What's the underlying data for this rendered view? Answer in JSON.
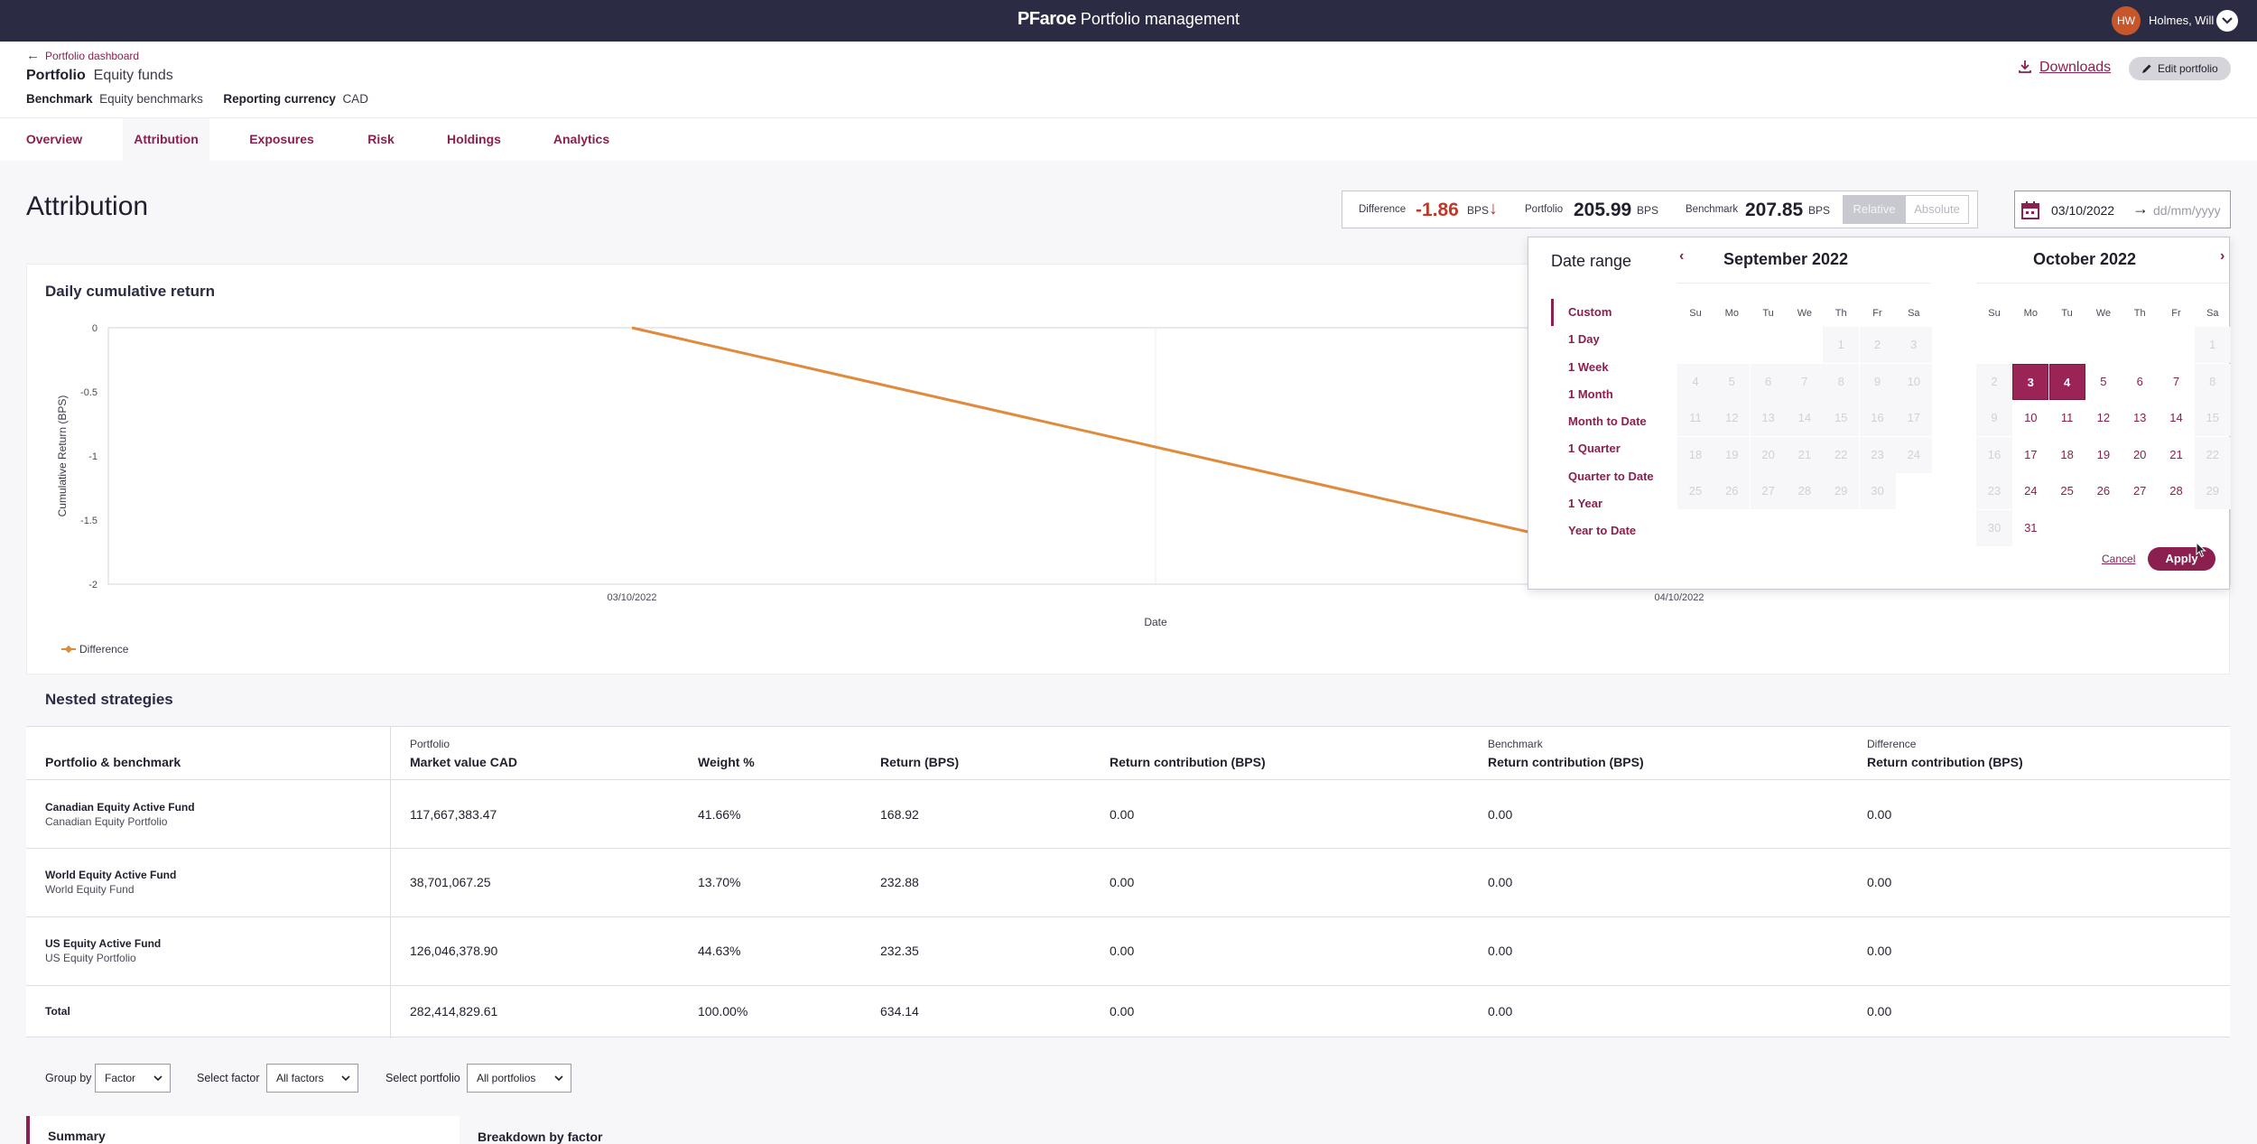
{
  "app": {
    "brand": "PFaroe",
    "title": "Portfolio management",
    "user": {
      "initials": "HW",
      "name": "Holmes, Will"
    }
  },
  "header": {
    "back_label": "Portfolio dashboard",
    "portfolio_key": "Portfolio",
    "portfolio_value": "Equity funds",
    "benchmark_key": "Benchmark",
    "benchmark_value": "Equity benchmarks",
    "currency_key": "Reporting currency",
    "currency_value": "CAD",
    "downloads_label": "Downloads",
    "edit_label": "Edit portfolio"
  },
  "tabs": [
    {
      "label": "Overview"
    },
    {
      "label": "Attribution"
    },
    {
      "label": "Exposures"
    },
    {
      "label": "Risk"
    },
    {
      "label": "Holdings"
    },
    {
      "label": "Analytics"
    }
  ],
  "page_title": "Attribution",
  "summary": {
    "difference_label": "Difference",
    "difference_value": "-1.86",
    "difference_unit": "BPS",
    "difference_arrow": "↓",
    "portfolio_label": "Portfolio",
    "portfolio_value": "205.99",
    "portfolio_unit": "BPS",
    "benchmark_label": "Benchmark",
    "benchmark_value": "207.85",
    "benchmark_unit": "BPS",
    "relative_label": "Relative",
    "absolute_label": "Absolute"
  },
  "date_field": {
    "from": "03/10/2022",
    "arrow": "→",
    "to_placeholder": "dd/mm/yyyy"
  },
  "chart": {
    "title": "Daily cumulative return",
    "legend_label": "Difference"
  },
  "chart_data": {
    "type": "line",
    "title": "Daily cumulative return",
    "xlabel": "Date",
    "ylabel": "Cumulative Return (BPS)",
    "x": [
      "03/10/2022",
      "04/10/2022"
    ],
    "series": [
      {
        "name": "Difference",
        "values": [
          0,
          -1.86
        ],
        "color": "#e08a3c"
      }
    ],
    "ylim": [
      -2,
      0
    ],
    "yticks": [
      "0",
      "-0.5",
      "-1",
      "-1.5",
      "-2"
    ],
    "grid": true,
    "legend": "bottom-left"
  },
  "nested": {
    "title": "Nested strategies",
    "group_portfolio": "Portfolio",
    "group_benchmark": "Benchmark",
    "group_difference": "Difference",
    "headers": {
      "name": "Portfolio & benchmark",
      "market_value": "Market value CAD",
      "weight": "Weight %",
      "return": "Return (BPS)",
      "contribution": "Return contribution (BPS)",
      "bench_contribution": "Return contribution (BPS)",
      "diff_contribution": "Return contribution (BPS)"
    },
    "rows": [
      {
        "name": "Canadian Equity Active Fund",
        "sub": "Canadian Equity Portfolio",
        "mv": "117,667,383.47",
        "weight": "41.66%",
        "ret": "168.92",
        "contrib": "0.00",
        "bench": "0.00",
        "diff": "0.00"
      },
      {
        "name": "World Equity Active Fund",
        "sub": "World Equity Fund",
        "mv": "38,701,067.25",
        "weight": "13.70%",
        "ret": "232.88",
        "contrib": "0.00",
        "bench": "0.00",
        "diff": "0.00"
      },
      {
        "name": "US Equity Active Fund",
        "sub": "US Equity Portfolio",
        "mv": "126,046,378.90",
        "weight": "44.63%",
        "ret": "232.35",
        "contrib": "0.00",
        "bench": "0.00",
        "diff": "0.00"
      },
      {
        "name": "Total",
        "sub": "",
        "mv": "282,414,829.61",
        "weight": "100.00%",
        "ret": "634.14",
        "contrib": "0.00",
        "bench": "0.00",
        "diff": "0.00"
      }
    ]
  },
  "filters": {
    "group_by_label": "Group by",
    "group_by_value": "Factor",
    "factor_label": "Select factor",
    "factor_value": "All factors",
    "portfolio_label": "Select portfolio",
    "portfolio_value": "All portfolios"
  },
  "bottom": {
    "summary_label": "Summary",
    "breakdown_label": "Breakdown by factor"
  },
  "date_picker": {
    "title": "Date range",
    "presets": [
      "Custom",
      "1 Day",
      "1 Week",
      "1 Month",
      "Month to Date",
      "1 Quarter",
      "Quarter to Date",
      "1 Year",
      "Year to Date"
    ],
    "active_preset": "Custom",
    "prev_icon": "‹",
    "next_icon": "›",
    "weekdays": [
      "Su",
      "Mo",
      "Tu",
      "We",
      "Th",
      "Fr",
      "Sa"
    ],
    "left_month": {
      "title": "September 2022",
      "first_weekday": 4,
      "days": 30,
      "enabled_days": []
    },
    "right_month": {
      "title": "October 2022",
      "first_weekday": 6,
      "days": 31,
      "enabled_days": [
        3,
        4,
        5,
        6,
        7,
        10,
        11,
        12,
        13,
        14,
        17,
        18,
        19,
        20,
        21,
        24,
        25,
        26,
        27,
        28,
        31
      ],
      "selected_days": [
        3,
        4
      ]
    },
    "cancel_label": "Cancel",
    "apply_label": "Apply"
  }
}
